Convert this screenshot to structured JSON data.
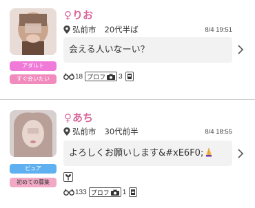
{
  "posts": [
    {
      "name": "りお",
      "location": "弘前市",
      "age": "20代半ば",
      "time": "8/4 19:51",
      "message": "会える人いなーい？",
      "tags": [
        {
          "label": "アダルト",
          "color": "#f07ad8"
        },
        {
          "label": "すぐ会いたい",
          "color": "#f28bbd"
        }
      ],
      "views": "18",
      "profile_label": "プロフ",
      "photos": "3"
    },
    {
      "name": "あち",
      "location": "弘前市",
      "age": "30代前半",
      "time": "8/4 18:55",
      "message": "よろしくお願いします&#xE6F0;",
      "tags": [
        {
          "label": "ピュア",
          "color": "#5fb0f0"
        },
        {
          "label": "初めての募集",
          "color": "#f2a9c6"
        }
      ],
      "views": "133",
      "profile_label": "プロフ",
      "photos": "1"
    }
  ],
  "icons": {
    "gender": "female-icon",
    "location": "map-pin-icon",
    "views": "glasses-icon",
    "camera": "camera-icon",
    "board": "board-icon",
    "plant": "plant-icon",
    "chevron": "chevron-right-icon",
    "praying": "praying-hands-emoji"
  },
  "colors": {
    "name": "#d9679a",
    "message_bg": "#f2f2f2"
  }
}
